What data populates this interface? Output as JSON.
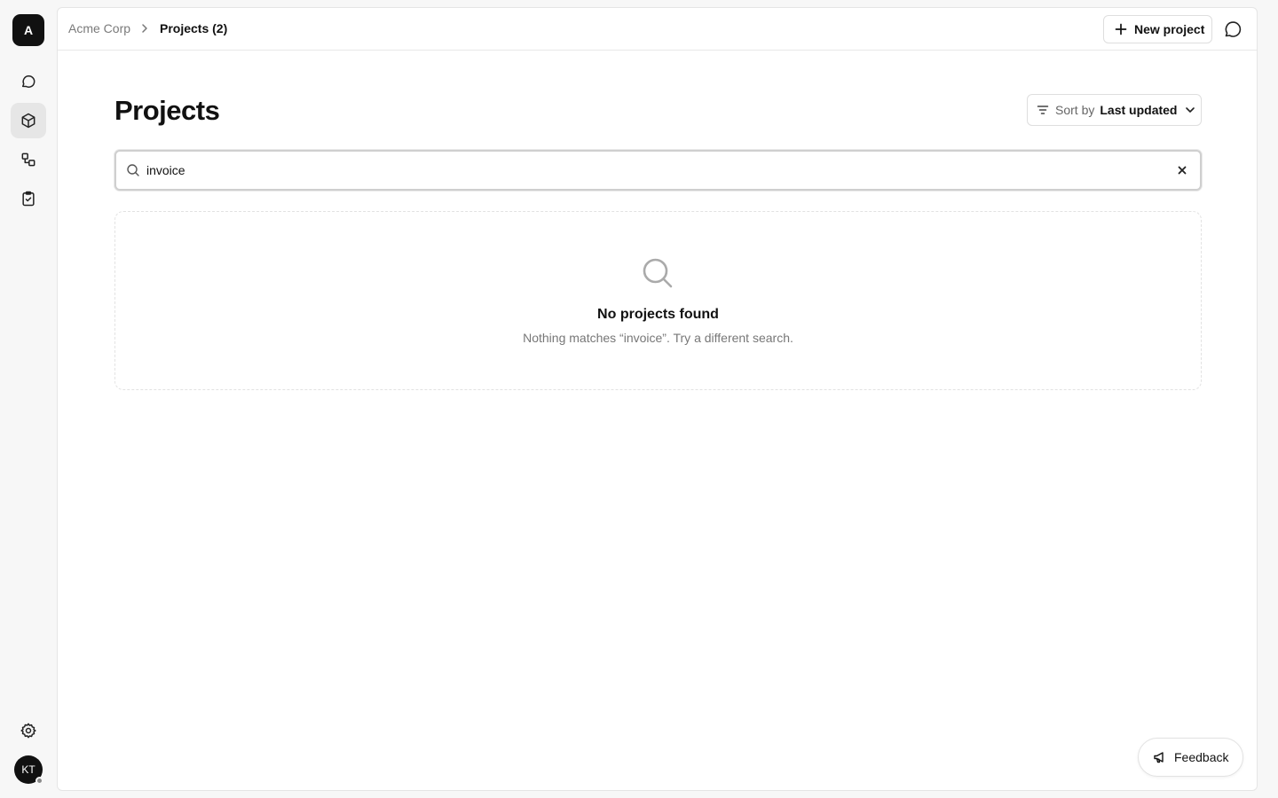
{
  "rail": {
    "org_initial": "A",
    "nav": [
      {
        "icon": "chat-bubble-icon"
      },
      {
        "icon": "cube-icon",
        "active": true
      },
      {
        "icon": "workflow-icon"
      },
      {
        "icon": "clipboard-check-icon"
      }
    ],
    "settings_icon": "gear-icon",
    "user_initials": "KT"
  },
  "breadcrumb": {
    "root": "Acme Corp",
    "current": "Projects (2)"
  },
  "toolbar": {
    "new_project_label": "New project"
  },
  "page": {
    "title": "Projects"
  },
  "sort": {
    "label": "Sort by",
    "value": "Last updated"
  },
  "search": {
    "value": "invoice"
  },
  "empty_state": {
    "title": "No projects found",
    "message": "Nothing matches “invoice”. Try a different search."
  },
  "feedback": {
    "label": "Feedback"
  },
  "colors": {
    "background": "#f7f7f7",
    "panel": "#ffffff",
    "text": "#111111",
    "muted": "#777777",
    "border": "#e5e5e5"
  }
}
